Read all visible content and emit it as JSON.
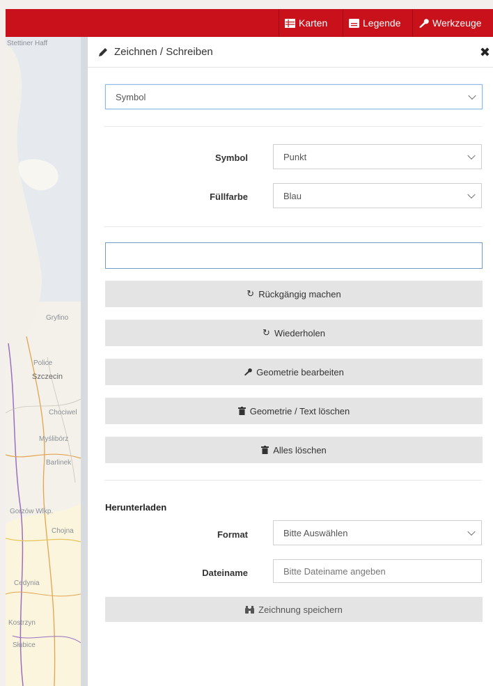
{
  "toolbar": {
    "items": [
      {
        "label": "Karten",
        "icon": "table-icon"
      },
      {
        "label": "Legende",
        "icon": "legend-icon"
      },
      {
        "label": "Werkzeuge",
        "icon": "wrench-icon"
      }
    ]
  },
  "map": {
    "labels": [
      "Stettiner Haff",
      "Gryfino",
      "Police",
      "Szczecin",
      "Chociwel",
      "Myślibórz",
      "Barlinek",
      "Gorzów Wlkp.",
      "Chojna",
      "Cedynia",
      "Kostrzyn",
      "Słubice"
    ]
  },
  "panel": {
    "title": "Zeichnen / Schreiben",
    "mode_select": {
      "value": "Symbol"
    },
    "symbol_label": "Symbol",
    "symbol_select": {
      "value": "Punkt"
    },
    "fill_label": "Füllfarbe",
    "fill_select": {
      "value": "Blau"
    },
    "text_input": {
      "value": "",
      "placeholder": ""
    },
    "buttons": {
      "undo": "Rückgängig machen",
      "redo": "Wiederholen",
      "edit": "Geometrie bearbeiten",
      "delete": "Geometrie / Text löschen",
      "delete_all": "Alles löschen"
    },
    "download": {
      "title": "Herunterladen",
      "format_label": "Format",
      "format_select": {
        "value": "Bitte Auswählen"
      },
      "filename_label": "Dateiname",
      "filename_input": {
        "value": "",
        "placeholder": "Bitte Dateiname angeben"
      },
      "save_button": "Zeichnung speichern"
    }
  },
  "colors": {
    "brand_red": "#c8111a",
    "button_gray": "#e4e4e4",
    "focus_blue": "#6f9cc7"
  }
}
